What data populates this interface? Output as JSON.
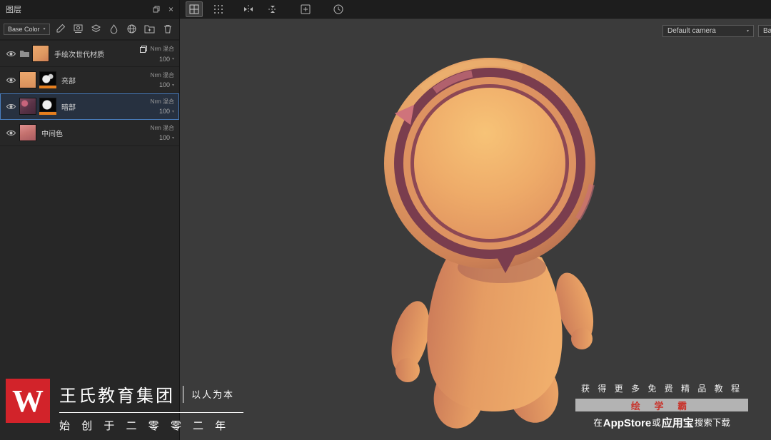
{
  "icons": {
    "chevron_down": "▾",
    "close": "×"
  },
  "layers_panel": {
    "title": "图层",
    "channel_select": "Base Color",
    "layers": [
      {
        "label": "手绘次世代材质",
        "blend": "Nrm 混合",
        "opacity": "100"
      },
      {
        "label": "亮部",
        "blend": "Nrm 混合",
        "opacity": "100"
      },
      {
        "label": "暗部",
        "blend": "Nrm 混合",
        "opacity": "100"
      },
      {
        "label": "中间色",
        "blend": "Nrm 混合",
        "opacity": "100"
      }
    ]
  },
  "viewport": {
    "camera_select": "Default camera",
    "partial_select": "Bas"
  },
  "character": {
    "base_color": "#e49a62",
    "highlight_color": "#f6c077",
    "ring_color": "#7a3d4e",
    "accent_pink": "#c9707a"
  },
  "branding_left": {
    "logo_letter": "W",
    "logo_color": "#d2232a",
    "company": "王氏教育集团",
    "slogan": "以人为本",
    "founded": "始 创 于 二 零 零 二 年"
  },
  "branding_right": {
    "line1": "获 得 更 多 免 费 精 品 教 程",
    "app_name": "绘 学 霸",
    "line3_pre": "在",
    "line3_appstore": "AppStore",
    "line3_or": "或",
    "line3_store": "应用宝",
    "line3_post": "搜索下载"
  }
}
